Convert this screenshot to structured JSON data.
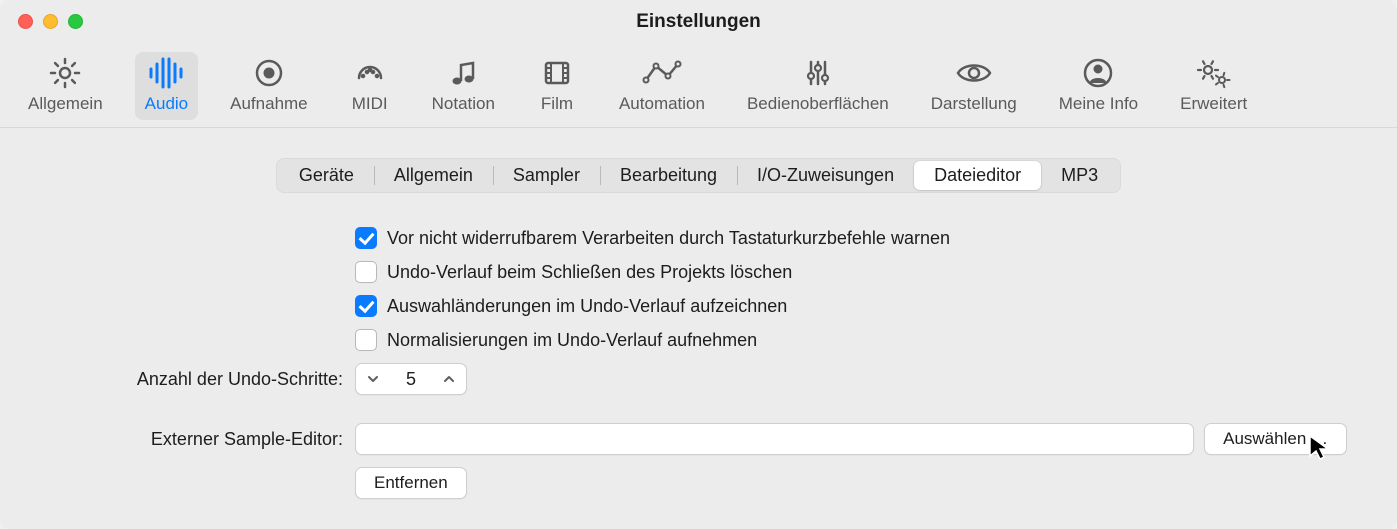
{
  "window": {
    "title": "Einstellungen"
  },
  "toolbar": [
    {
      "id": "allgemein",
      "label": "Allgemein",
      "icon": "gear-icon",
      "active": false
    },
    {
      "id": "audio",
      "label": "Audio",
      "icon": "waveform-icon",
      "active": true
    },
    {
      "id": "aufnahme",
      "label": "Aufnahme",
      "icon": "record-icon",
      "active": false
    },
    {
      "id": "midi",
      "label": "MIDI",
      "icon": "midi-icon",
      "active": false
    },
    {
      "id": "notation",
      "label": "Notation",
      "icon": "notes-icon",
      "active": false
    },
    {
      "id": "film",
      "label": "Film",
      "icon": "film-icon",
      "active": false
    },
    {
      "id": "automation",
      "label": "Automation",
      "icon": "automation-icon",
      "active": false
    },
    {
      "id": "bedienoberflaechen",
      "label": "Bedienoberflächen",
      "icon": "sliders-icon",
      "active": false
    },
    {
      "id": "darstellung",
      "label": "Darstellung",
      "icon": "eye-icon",
      "active": false
    },
    {
      "id": "meine-info",
      "label": "Meine Info",
      "icon": "person-icon",
      "active": false
    },
    {
      "id": "erweitert",
      "label": "Erweitert",
      "icon": "gears-icon",
      "active": false
    }
  ],
  "subtabs": [
    {
      "id": "geraete",
      "label": "Geräte",
      "selected": false
    },
    {
      "id": "allgemein2",
      "label": "Allgemein",
      "selected": false
    },
    {
      "id": "sampler",
      "label": "Sampler",
      "selected": false
    },
    {
      "id": "bearbeitung",
      "label": "Bearbeitung",
      "selected": false
    },
    {
      "id": "iozuweisungen",
      "label": "I/O-Zuweisungen",
      "selected": false
    },
    {
      "id": "dateieditor",
      "label": "Dateieditor",
      "selected": true
    },
    {
      "id": "mp3",
      "label": "MP3",
      "selected": false
    }
  ],
  "checks": [
    {
      "id": "warn-irrevocable",
      "label": "Vor nicht widerrufbarem Verarbeiten durch Tastaturkurzbefehle warnen",
      "checked": true
    },
    {
      "id": "clear-undo-close",
      "label": "Undo-Verlauf beim Schließen des Projekts löschen",
      "checked": false
    },
    {
      "id": "record-selection-undo",
      "label": "Auswahländerungen im Undo-Verlauf aufzeichnen",
      "checked": true
    },
    {
      "id": "record-normalize-undo",
      "label": "Normalisierungen im Undo-Verlauf aufnehmen",
      "checked": false
    }
  ],
  "undo_steps": {
    "label": "Anzahl der Undo-Schritte:",
    "value": "5"
  },
  "external_editor": {
    "label": "Externer Sample-Editor:",
    "value": "",
    "choose_label": "Auswählen …",
    "remove_label": "Entfernen"
  }
}
